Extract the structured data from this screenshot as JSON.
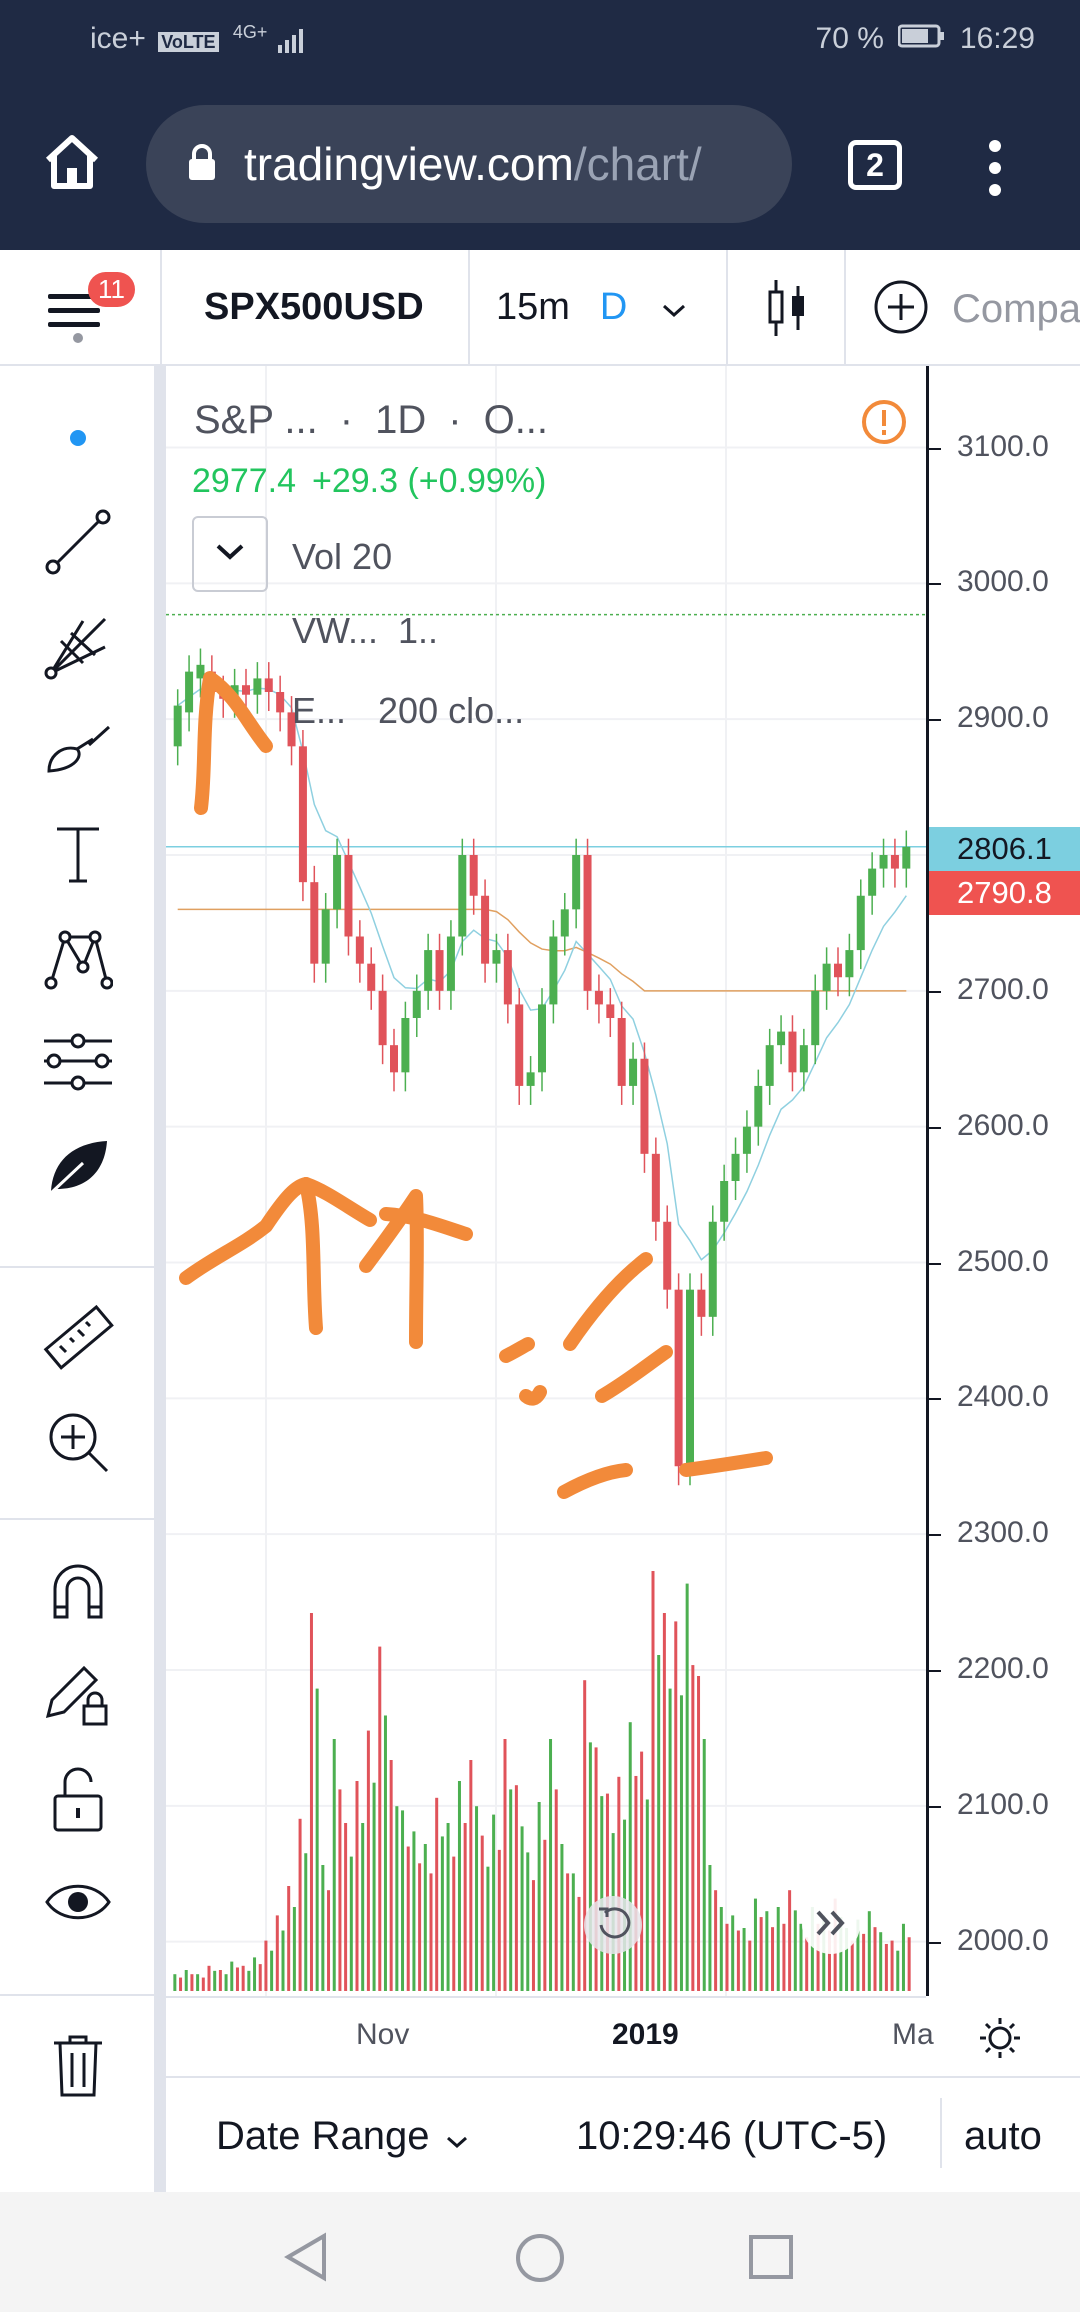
{
  "status": {
    "carrier": "ice+",
    "volte": "VoLTE",
    "network": "4G+",
    "battery": "70 %",
    "time": "16:29"
  },
  "browser": {
    "url_main": "tradingview.com",
    "url_rest": "/chart/",
    "tab_count": "2"
  },
  "toolbar": {
    "notifications": "11",
    "symbol": "SPX500USD",
    "interval": "15m",
    "interval_flag": "D",
    "compare": "Compa"
  },
  "legend": {
    "title": "S&P ...",
    "interval": "1D",
    "ohlc": "O...",
    "price": "2977.4",
    "change": "+29.3 (+0.99%)",
    "indicators": [
      {
        "name": "Vol 20"
      },
      {
        "name": "VW...",
        "value": "1.."
      },
      {
        "name": "E...",
        "value": "200 clo..."
      }
    ]
  },
  "price_axis": {
    "labels": [
      "3100.0",
      "3000.0",
      "2900.0",
      "2806.1",
      "2790.8",
      "2700.0",
      "2600.0",
      "2500.0",
      "2400.0",
      "2300.0",
      "2200.0",
      "2100.0",
      "2000.0"
    ],
    "tag_blue": "2806.1",
    "tag_red": "2790.8"
  },
  "time_axis": {
    "labels": [
      "Nov",
      "2019",
      "Ma"
    ]
  },
  "bottom": {
    "date_range": "Date Range",
    "clock": "10:29:46 (UTC-5)",
    "scale": "auto"
  },
  "colors": {
    "up": "#26a69a",
    "up_candle": "#4caf50",
    "down": "#ef5350",
    "ann": "#f28a3a",
    "tag_blue": "#7ccfe0",
    "tag_red": "#ef5350",
    "accent": "#2196f3",
    "topbar": "#1f2a44"
  },
  "icons": {
    "left": [
      "cursor-dot-icon",
      "trend-line-icon",
      "pitchfork-icon",
      "brush-icon",
      "text-icon",
      "pattern-icon",
      "prediction-icon",
      "leaf-icon",
      "ruler-icon",
      "zoom-in-icon",
      "magnet-icon",
      "lock-pencil-icon",
      "lock-icon",
      "eye-icon",
      "trash-icon"
    ]
  },
  "chart_data": {
    "type": "candlestick",
    "series": [
      {
        "name": "S&P ...",
        "points": [
          [
            0,
            2880,
            2910
          ],
          [
            1,
            2905,
            2935
          ],
          [
            2,
            2930,
            2940
          ],
          [
            3,
            2935,
            2920
          ],
          [
            4,
            2920,
            2915
          ],
          [
            5,
            2915,
            2925
          ],
          [
            6,
            2925,
            2918
          ],
          [
            7,
            2918,
            2930
          ],
          [
            8,
            2930,
            2920
          ],
          [
            9,
            2920,
            2905
          ],
          [
            10,
            2905,
            2880
          ],
          [
            11,
            2880,
            2780
          ],
          [
            12,
            2780,
            2720
          ],
          [
            13,
            2720,
            2760
          ],
          [
            14,
            2760,
            2800
          ],
          [
            15,
            2800,
            2740
          ],
          [
            16,
            2740,
            2720
          ],
          [
            17,
            2720,
            2700
          ],
          [
            18,
            2700,
            2660
          ],
          [
            19,
            2660,
            2640
          ],
          [
            20,
            2640,
            2680
          ],
          [
            21,
            2680,
            2700
          ],
          [
            22,
            2700,
            2730
          ],
          [
            23,
            2730,
            2700
          ],
          [
            24,
            2700,
            2740
          ],
          [
            25,
            2740,
            2800
          ],
          [
            26,
            2800,
            2770
          ],
          [
            27,
            2770,
            2720
          ],
          [
            28,
            2720,
            2730
          ],
          [
            29,
            2730,
            2690
          ],
          [
            30,
            2690,
            2630
          ],
          [
            31,
            2630,
            2640
          ],
          [
            32,
            2640,
            2690
          ],
          [
            33,
            2690,
            2740
          ],
          [
            34,
            2740,
            2760
          ],
          [
            35,
            2760,
            2800
          ],
          [
            36,
            2800,
            2700
          ],
          [
            37,
            2700,
            2690
          ],
          [
            38,
            2690,
            2680
          ],
          [
            39,
            2680,
            2630
          ],
          [
            40,
            2630,
            2650
          ],
          [
            41,
            2650,
            2580
          ],
          [
            42,
            2580,
            2530
          ],
          [
            43,
            2530,
            2480
          ],
          [
            44,
            2480,
            2350
          ],
          [
            45,
            2350,
            2480
          ],
          [
            46,
            2480,
            2460
          ],
          [
            47,
            2460,
            2530
          ],
          [
            48,
            2530,
            2560
          ],
          [
            49,
            2560,
            2580
          ],
          [
            50,
            2580,
            2600
          ],
          [
            51,
            2600,
            2630
          ],
          [
            52,
            2630,
            2660
          ],
          [
            53,
            2660,
            2670
          ],
          [
            54,
            2670,
            2640
          ],
          [
            55,
            2640,
            2660
          ],
          [
            56,
            2660,
            2700
          ],
          [
            57,
            2700,
            2720
          ],
          [
            58,
            2720,
            2710
          ],
          [
            59,
            2710,
            2730
          ],
          [
            60,
            2730,
            2770
          ],
          [
            61,
            2770,
            2790
          ],
          [
            62,
            2790,
            2800
          ],
          [
            63,
            2800,
            2790
          ],
          [
            64,
            2790,
            2806
          ]
        ]
      },
      {
        "name": "Vol 20",
        "values": [
          0.04,
          0.05,
          0.04,
          0.06,
          0.05,
          0.07,
          0.06,
          0.08,
          0.12,
          0.18,
          0.25,
          0.41,
          0.9,
          0.3,
          0.6,
          0.4,
          0.5,
          0.62,
          0.82,
          0.55,
          0.43,
          0.38,
          0.35,
          0.46,
          0.4,
          0.5,
          0.55,
          0.37,
          0.42,
          0.6,
          0.49,
          0.33,
          0.45,
          0.6,
          0.35,
          0.28,
          0.74,
          0.58,
          0.47,
          0.51,
          0.64,
          0.57,
          1.0,
          0.9,
          0.88,
          0.97,
          0.75,
          0.3,
          0.2,
          0.18,
          0.15,
          0.22,
          0.19,
          0.2,
          0.24,
          0.16,
          0.2,
          0.18,
          0.22,
          0.15,
          0.17,
          0.19,
          0.14,
          0.12,
          0.16
        ]
      }
    ],
    "ylim": [
      1960,
      3160
    ]
  }
}
